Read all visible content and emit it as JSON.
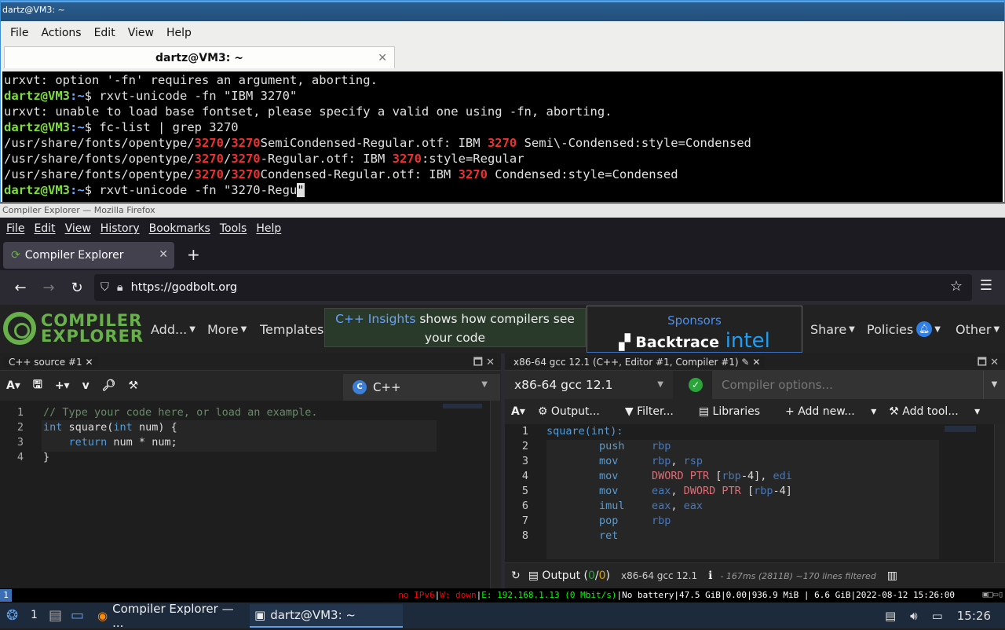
{
  "terminal": {
    "title": "dartz@VM3: ~",
    "menu": [
      "File",
      "Actions",
      "Edit",
      "View",
      "Help"
    ],
    "tab_label": "dartz@VM3: ~",
    "lines": [
      {
        "plain": "urxvt: option '-fn' requires an argument, aborting."
      },
      {
        "user": "dartz@VM3",
        "path": ":~",
        "cmd": "$ rxvt-unicode -fn \"IBM 3270\""
      },
      {
        "plain": "urxvt: unable to load base fontset, please specify a valid one using -fn, aborting."
      },
      {
        "user": "dartz@VM3",
        "path": ":~",
        "cmd": "$ fc-list | grep 3270"
      },
      {
        "segs": [
          "/usr/share/fonts/opentype/",
          "3270",
          "/",
          "3270",
          "SemiCondensed-Regular.otf: IBM ",
          "3270",
          " Semi\\-Condensed:style=Condensed"
        ]
      },
      {
        "segs": [
          "/usr/share/fonts/opentype/",
          "3270",
          "/",
          "3270",
          "-Regular.otf: IBM ",
          "3270",
          ":style=Regular"
        ]
      },
      {
        "segs": [
          "/usr/share/fonts/opentype/",
          "3270",
          "/",
          "3270",
          "Condensed-Regular.otf: IBM ",
          "3270",
          " Condensed:style=Condensed"
        ]
      },
      {
        "user": "dartz@VM3",
        "path": ":~",
        "cmd": "$ rxvt-unicode -fn \"3270-Regu",
        "cursor": "\""
      }
    ]
  },
  "firefox": {
    "title": "Compiler Explorer — Mozilla Firefox",
    "menu": [
      "File",
      "Edit",
      "View",
      "History",
      "Bookmarks",
      "Tools",
      "Help"
    ],
    "tab_label": "Compiler Explorer",
    "url": "https://godbolt.org"
  },
  "ce": {
    "logo_line1": "COMPILER",
    "logo_line2": "EXPLORER",
    "add": "Add...",
    "more": "More",
    "templates": "Templates",
    "insights_link": "C++ Insights",
    "insights_text1": " shows how compilers see",
    "insights_text2": "your code",
    "sponsors": "Sponsors",
    "sponsor1": "Backtrace",
    "sponsor2": "intel",
    "share": "Share",
    "policies": "Policies",
    "other": "Other"
  },
  "source": {
    "tab": "C++ source #1",
    "language": "C++",
    "lines": [
      "1",
      "2",
      "3",
      "4"
    ],
    "code": {
      "l1": "// Type your code here, or load an example.",
      "l2a": "int",
      "l2b": " square(",
      "l2c": "int",
      "l2d": " num) {",
      "l3a": "    ",
      "l3b": "return",
      "l3c": " num * num;",
      "l4": "}"
    }
  },
  "compiler": {
    "tab": "x86-64 gcc 12.1 (C++, Editor #1, Compiler #1)",
    "name": "x86-64 gcc 12.1",
    "options_placeholder": "Compiler options...",
    "toolbar": {
      "output": "Output...",
      "filter": "Filter...",
      "libraries": "Libraries",
      "add_new": "Add new...",
      "add_tool": "Add tool..."
    },
    "lines": [
      "1",
      "2",
      "3",
      "4",
      "5",
      "6",
      "7",
      "8"
    ],
    "asm": [
      {
        "label": "square(int):"
      },
      {
        "op": "push",
        "a": "rbp"
      },
      {
        "op": "mov",
        "a": "rbp",
        ",": ", ",
        "b": "rsp"
      },
      {
        "op": "mov",
        "a": "DWORD PTR [rbp-4]",
        "b": "edi"
      },
      {
        "op": "mov",
        "a": "eax",
        "b": "DWORD PTR [rbp-4]"
      },
      {
        "op": "imul",
        "a": "eax",
        "b": "eax"
      },
      {
        "op": "pop",
        "a": "rbp"
      },
      {
        "op": "ret"
      }
    ],
    "status_output": "Output (",
    "status_zero": "0",
    "status_slash": "/",
    "status_zero2": "0",
    "status_close": ")",
    "status_compiler": "x86-64 gcc 12.1",
    "status_info": "- 167ms (2811B) ~170 lines filtered"
  },
  "i3bar": {
    "workspace": "1",
    "ipv6": "no IPv6",
    "wifi": "W: down",
    "eth": "E: 192.168.1.13 (0 Mbit/s)",
    "battery": "No battery",
    "disk": "47.5 GiB",
    "load": "0.00",
    "mem": "936.9 MiB | 6.6 GiB",
    "datetime": "2022-08-12 15:26:00"
  },
  "taskbar": {
    "workspace": "1",
    "task1": "Compiler Explorer — ...",
    "task2": "dartz@VM3: ~",
    "clock": "15:26"
  }
}
